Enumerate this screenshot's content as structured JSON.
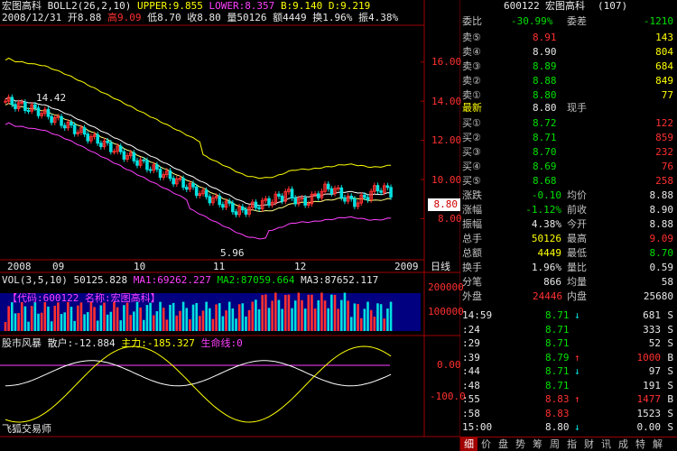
{
  "header": {
    "stock_name": "宏图高科",
    "boll_label": "BOLL2(26,2,10)",
    "upper": "UPPER:9.855",
    "lower": "LOWER:8.357",
    "b": "B:9.140",
    "d": "D:9.219",
    "date": "2008/12/31",
    "open": "开8.88",
    "high": "高9.09",
    "low": "低8.70",
    "close": "收8.80",
    "vol": "量50126",
    "amount": "额4449",
    "turnover": "换1.96%",
    "amplitude": "振4.38%"
  },
  "price_axis": [
    "16.00",
    "14.00",
    "12.00",
    "10.00",
    "8.00"
  ],
  "price_marks": {
    "high_mark": "14.42",
    "low_mark": "5.96",
    "current_tag": "8.80"
  },
  "date_axis": [
    "2008",
    "09",
    "10",
    "11",
    "12",
    "2009"
  ],
  "period_label": "日线",
  "vol_header": {
    "label": "VOL(3,5,10)",
    "v": "50125.828",
    "ma1": "MA1:69262.227",
    "ma2": "MA2:87059.664",
    "ma3": "MA3:87652.117"
  },
  "vol_axis": [
    "200000",
    "100000"
  ],
  "vol_info": "【代码:600122 名称:宏图高科】",
  "ind_header": {
    "name": "股市风暴",
    "retail": "散户:-12.884",
    "main": "主力:-185.327",
    "life": "生命线:0"
  },
  "ind_axis": [
    "0.00",
    "-100.0"
  ],
  "watermark": "飞狐交易师",
  "quote": {
    "code": "600122",
    "title": "宏图高科",
    "count": "(107)",
    "weibi_label": "委比",
    "weibi": "-30.99%",
    "weicha_label": "委差",
    "weicha": "-1210",
    "sells": [
      {
        "label": "卖⑤",
        "price": "8.91",
        "vol": "143"
      },
      {
        "label": "卖④",
        "price": "8.90",
        "vol": "804"
      },
      {
        "label": "卖③",
        "price": "8.89",
        "vol": "684"
      },
      {
        "label": "卖②",
        "price": "8.88",
        "vol": "849"
      },
      {
        "label": "卖①",
        "price": "8.80",
        "vol": "77"
      }
    ],
    "last_label": "最新",
    "last": "8.80",
    "hand_label": "现手",
    "hand": "",
    "buys": [
      {
        "label": "买①",
        "price": "8.72",
        "vol": "122"
      },
      {
        "label": "买②",
        "price": "8.71",
        "vol": "859"
      },
      {
        "label": "买③",
        "price": "8.70",
        "vol": "232"
      },
      {
        "label": "买④",
        "price": "8.69",
        "vol": "76"
      },
      {
        "label": "买⑤",
        "price": "8.68",
        "vol": "258"
      }
    ],
    "stats": [
      {
        "l1": "涨跌",
        "v1": "-0.10",
        "l2": "均价",
        "v2": "8.88"
      },
      {
        "l1": "涨幅",
        "v1": "-1.12%",
        "l2": "前收",
        "v2": "8.90"
      },
      {
        "l1": "振幅",
        "v1": "4.38%",
        "l2": "今开",
        "v2": "8.88"
      },
      {
        "l1": "总手",
        "v1": "50126",
        "l2": "最高",
        "v2": "9.09"
      },
      {
        "l1": "总额",
        "v1": "4449",
        "l2": "最低",
        "v2": "8.70"
      },
      {
        "l1": "换手",
        "v1": "1.96%",
        "l2": "量比",
        "v2": "0.59"
      },
      {
        "l1": "分笔",
        "v1": "866",
        "l2": "均量",
        "v2": "58"
      }
    ],
    "outer_label": "外盘",
    "outer": "24446",
    "inner_label": "内盘",
    "inner": "25680"
  },
  "ticks": [
    {
      "t": "14:59",
      "p": "8.71",
      "a": "↓",
      "v": "681",
      "s": "S"
    },
    {
      "t": ":24",
      "p": "8.71",
      "a": "",
      "v": "333",
      "s": "S"
    },
    {
      "t": ":29",
      "p": "8.71",
      "a": "",
      "v": "52",
      "s": "S"
    },
    {
      "t": ":39",
      "p": "8.79",
      "a": "↑",
      "v": "1000",
      "s": "B"
    },
    {
      "t": ":44",
      "p": "8.71",
      "a": "↓",
      "v": "97",
      "s": "S"
    },
    {
      "t": ":48",
      "p": "8.71",
      "a": "",
      "v": "191",
      "s": "S"
    },
    {
      "t": ":55",
      "p": "8.83",
      "a": "↑",
      "v": "1477",
      "s": "B"
    },
    {
      "t": ":58",
      "p": "8.83",
      "a": "",
      "v": "1523",
      "s": "S"
    },
    {
      "t": "15:00",
      "p": "8.80",
      "a": "↓",
      "v": "0.00",
      "s": "S"
    }
  ],
  "tabs": [
    "细",
    "价",
    "盘",
    "势",
    "筹",
    "周",
    "指",
    "财",
    "讯",
    "成",
    "特",
    "解"
  ],
  "colors": {
    "up": "#ff3030",
    "down": "#00e0e0",
    "upper": "#ffff00",
    "mid": "#ffffff",
    "lower": "#ff40ff",
    "grid": "#a00000"
  }
}
